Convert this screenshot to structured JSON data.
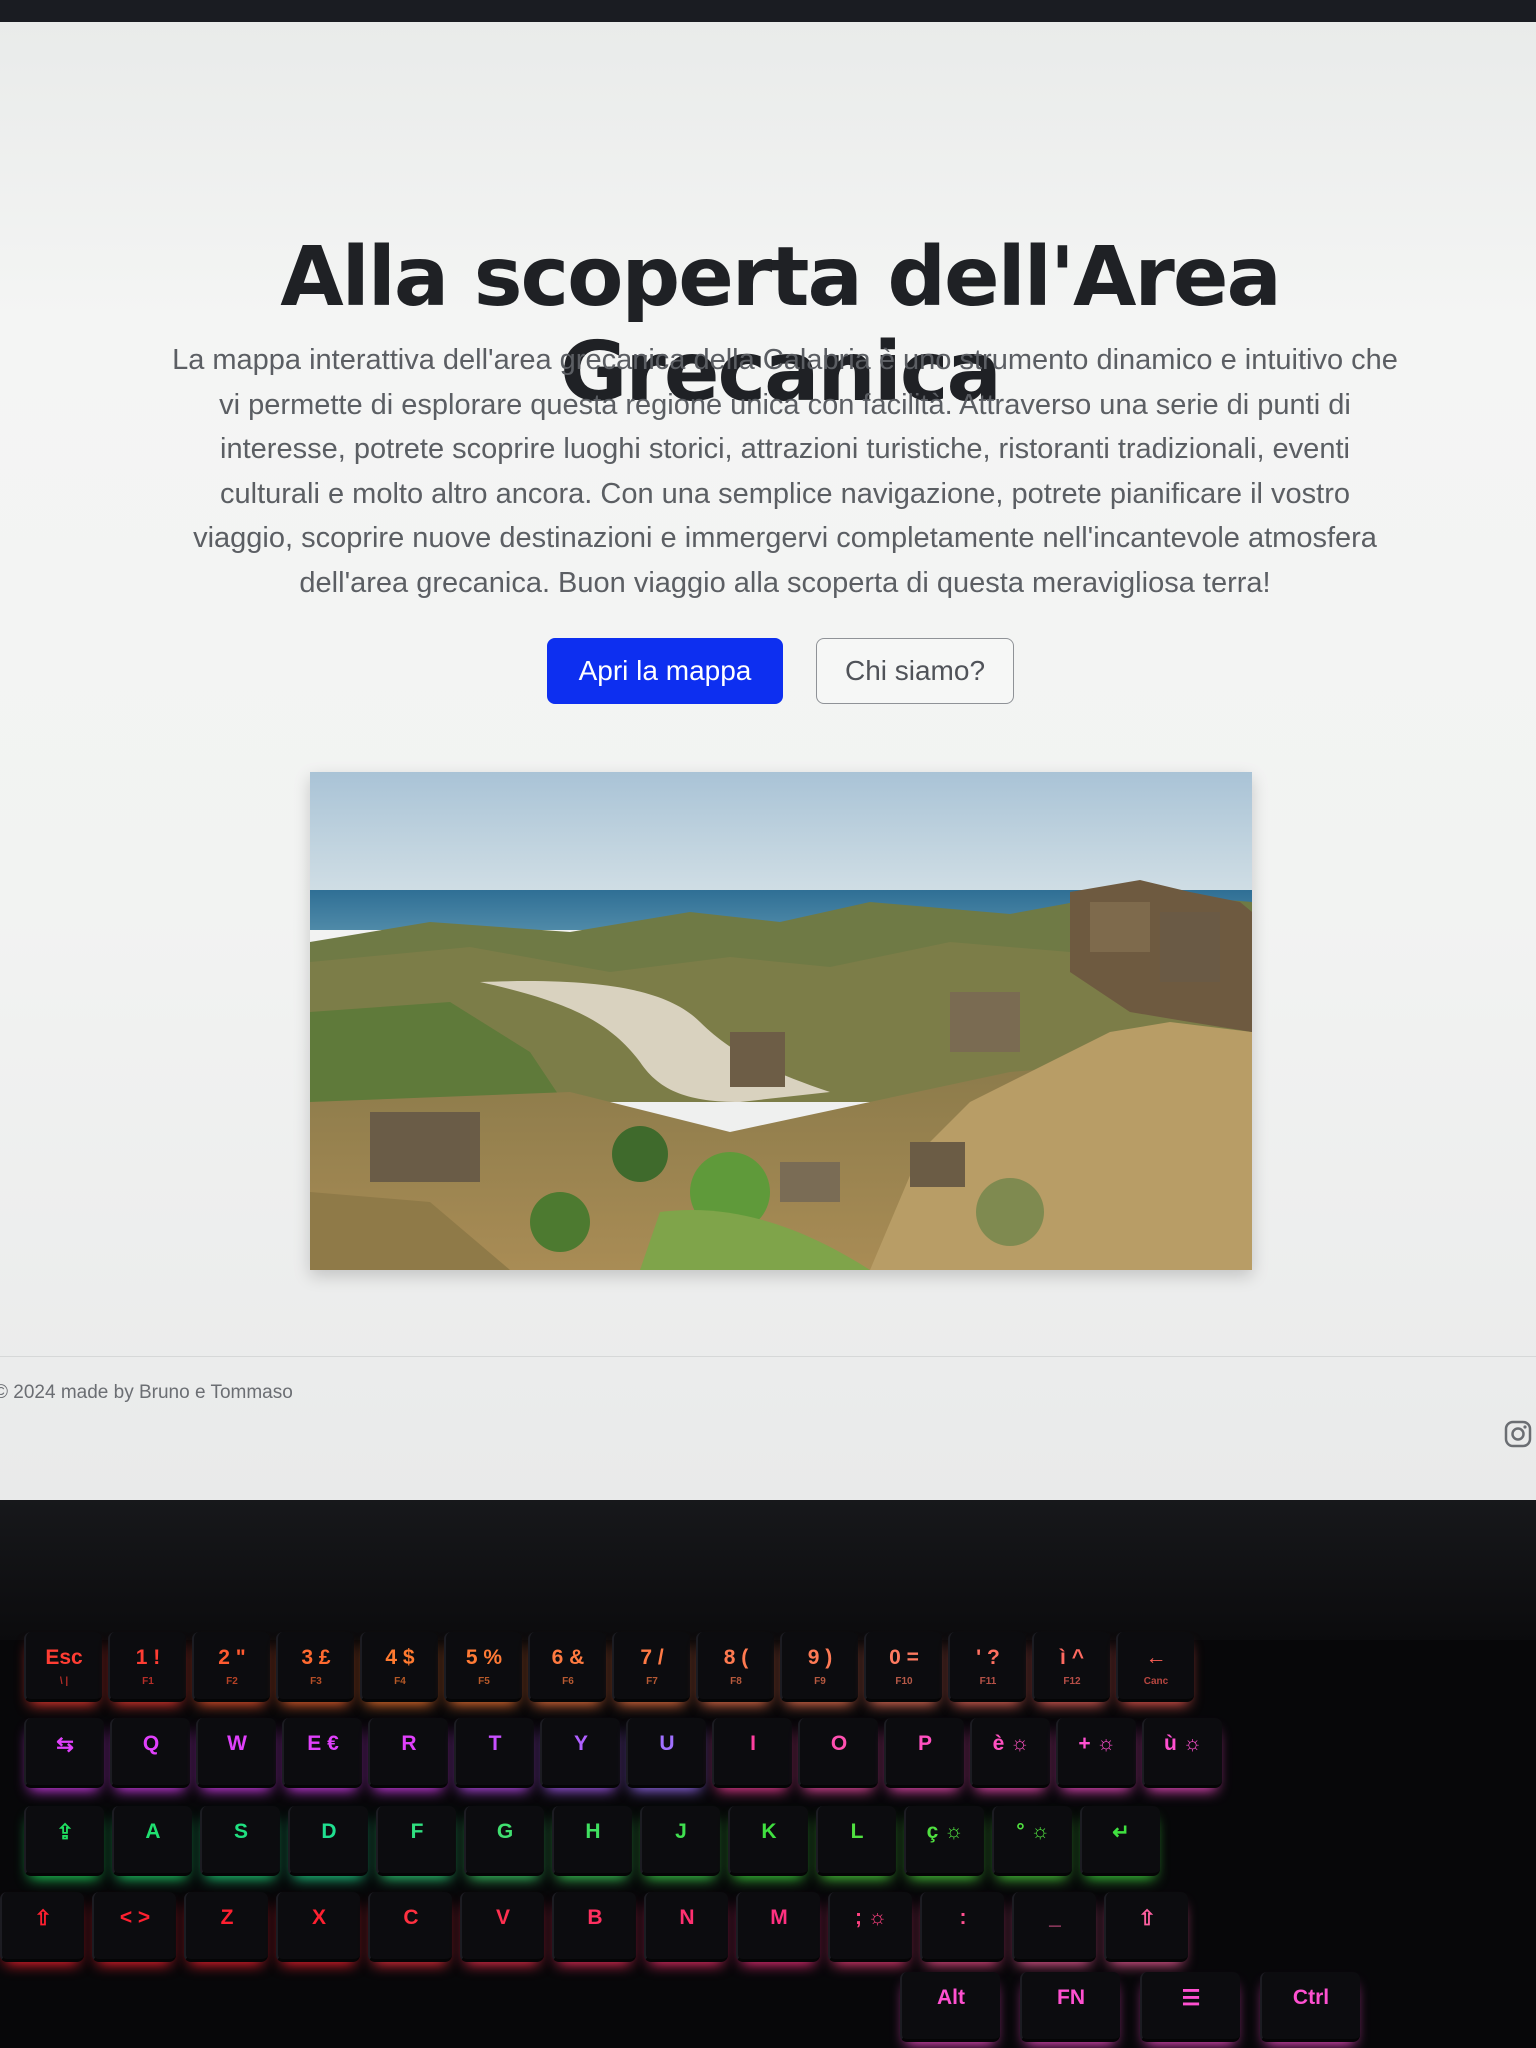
{
  "hero": {
    "title": "Alla scoperta dell'Area Grecanica",
    "lead": "La mappa interattiva dell'area grecanica della Calabria è uno strumento dinamico e intuitivo che vi permette di esplorare questa regione unica con facilità. Attraverso una serie di punti di interesse, potrete scoprire luoghi storici, attrazioni turistiche, ristoranti tradizionali, eventi culturali e molto altro ancora. Con una semplice navigazione, potrete pianificare il vostro viaggio, scoprire nuove destinazioni e immergervi completamente nell'incantevole atmosfera dell'area grecanica. Buon viaggio alla scoperta di questa meravigliosa terra!",
    "primary_button": "Apri la mappa",
    "secondary_button": "Chi siamo?"
  },
  "footer": {
    "copyright": "© 2024 made by Bruno e Tommaso",
    "social_icon": "instagram-icon"
  },
  "colors": {
    "primary": "#0d2ff0",
    "title": "#1f2125",
    "text": "#5b5e63"
  },
  "keyboard": {
    "row1": [
      {
        "cap": "Esc",
        "sub": "\\ |",
        "color": "#ff3d33"
      },
      {
        "cap": "1 !",
        "sub": "F1",
        "color": "#ff3d33"
      },
      {
        "cap": "2 \"",
        "sub": "F2",
        "color": "#ff5a30"
      },
      {
        "cap": "3 £",
        "sub": "F3",
        "color": "#ff6a30"
      },
      {
        "cap": "4 $",
        "sub": "F4",
        "color": "#ff7a30"
      },
      {
        "cap": "5 %",
        "sub": "F5",
        "color": "#ff7a35"
      },
      {
        "cap": "6 &",
        "sub": "F6",
        "color": "#ff7a40"
      },
      {
        "cap": "7 /",
        "sub": "F7",
        "color": "#ff7a45"
      },
      {
        "cap": "8 (",
        "sub": "F8",
        "color": "#ff7a50"
      },
      {
        "cap": "9 )",
        "sub": "F9",
        "color": "#ff7a55"
      },
      {
        "cap": "0 =",
        "sub": "F10",
        "color": "#ff7a60"
      },
      {
        "cap": "' ?",
        "sub": "F11",
        "color": "#ff7060"
      },
      {
        "cap": "ì ^",
        "sub": "F12",
        "color": "#ff6a60"
      },
      {
        "cap": "←",
        "sub": "Canc",
        "color": "#ff5f55"
      }
    ],
    "row2": [
      {
        "cap": "⇆",
        "color": "#e040fb"
      },
      {
        "cap": "Q",
        "color": "#e040fb"
      },
      {
        "cap": "W",
        "color": "#e040fb"
      },
      {
        "cap": "E €",
        "color": "#e040fb"
      },
      {
        "cap": "R",
        "color": "#e040fb"
      },
      {
        "cap": "T",
        "color": "#c850ff"
      },
      {
        "cap": "Y",
        "color": "#b060ff"
      },
      {
        "cap": "U",
        "color": "#a070ff"
      },
      {
        "cap": "I",
        "color": "#ff40a0"
      },
      {
        "cap": "O",
        "color": "#ff50b0"
      },
      {
        "cap": "P",
        "color": "#ff50c0"
      },
      {
        "cap": "è ☼",
        "color": "#ff50c0"
      },
      {
        "cap": "+ ☼",
        "color": "#ff50d0"
      },
      {
        "cap": "ù ☼",
        "color": "#ff50d0"
      }
    ],
    "row3": [
      {
        "cap": "⇪",
        "color": "#20e060"
      },
      {
        "cap": "A",
        "color": "#20e070"
      },
      {
        "cap": "S",
        "color": "#20e080"
      },
      {
        "cap": "D",
        "color": "#20e090"
      },
      {
        "cap": "F",
        "color": "#30e080"
      },
      {
        "cap": "G",
        "color": "#40e070"
      },
      {
        "cap": "H",
        "color": "#40e060"
      },
      {
        "cap": "J",
        "color": "#40e050"
      },
      {
        "cap": "K",
        "color": "#40e040"
      },
      {
        "cap": "L",
        "color": "#50e040"
      },
      {
        "cap": "ç ☼",
        "color": "#50e040"
      },
      {
        "cap": "° ☼",
        "color": "#50e040"
      },
      {
        "cap": "↵",
        "color": "#40e040"
      }
    ],
    "row4": [
      {
        "cap": "⇧",
        "color": "#ff2030"
      },
      {
        "cap": "< >",
        "color": "#ff2030"
      },
      {
        "cap": "Z",
        "color": "#ff2030"
      },
      {
        "cap": "X",
        "color": "#ff2030"
      },
      {
        "cap": "C",
        "color": "#ff3040"
      },
      {
        "cap": "V",
        "color": "#ff3050"
      },
      {
        "cap": "B",
        "color": "#ff3060"
      },
      {
        "cap": "N",
        "color": "#ff3070"
      },
      {
        "cap": "M",
        "color": "#ff3080"
      },
      {
        "cap": "; ☼",
        "color": "#ff4080"
      },
      {
        "cap": ":",
        "color": "#ff5090"
      },
      {
        "cap": "_",
        "color": "#ff60a0"
      },
      {
        "cap": "⇧",
        "color": "#ff60a0"
      }
    ],
    "row5": [
      {
        "cap": "Alt",
        "color": "#ff50d0"
      },
      {
        "cap": "FN",
        "color": "#ff50d0"
      },
      {
        "cap": "☰",
        "color": "#ff50d0"
      },
      {
        "cap": "Ctrl",
        "color": "#ff50d0"
      }
    ]
  }
}
